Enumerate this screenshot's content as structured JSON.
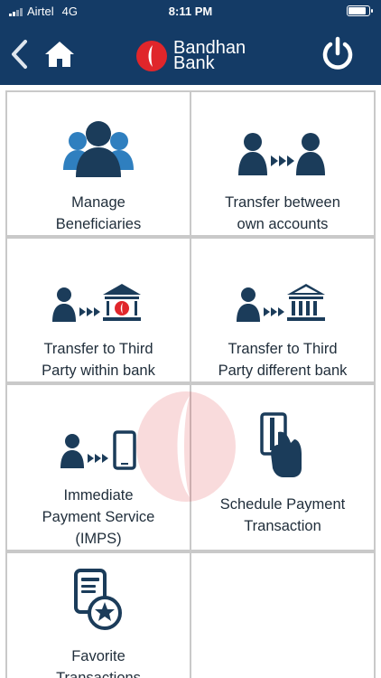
{
  "status_bar": {
    "carrier": "Airtel",
    "network": "4G",
    "time": "8:11 PM"
  },
  "header": {
    "logo_line1": "Bandhan",
    "logo_line2": "Bank",
    "icons": {
      "back": "chevron-left-icon",
      "home": "home-icon",
      "power": "power-icon"
    }
  },
  "colors": {
    "header_bg": "#143b66",
    "icon_navy": "#1b3c5a",
    "icon_blue": "#2f7fbf",
    "brand_red": "#e0262b",
    "tile_border": "#c9c9c9"
  },
  "tiles": [
    {
      "label": "Manage\nBeneficiaries",
      "icon": "beneficiaries-icon"
    },
    {
      "label": "Transfer between\nown accounts",
      "icon": "own-transfer-icon"
    },
    {
      "label": "Transfer to Third\nParty within bank",
      "icon": "bank-transfer-icon"
    },
    {
      "label": "Transfer to Third\nParty different bank",
      "icon": "other-bank-transfer-icon"
    },
    {
      "label": "Immediate\nPayment Service\n(IMPS)",
      "icon": "mobile-transfer-icon"
    },
    {
      "label": "Schedule Payment\nTransaction",
      "icon": "card-payment-icon"
    },
    {
      "label": "Favorite\nTransactions",
      "icon": "favorite-document-icon"
    }
  ]
}
